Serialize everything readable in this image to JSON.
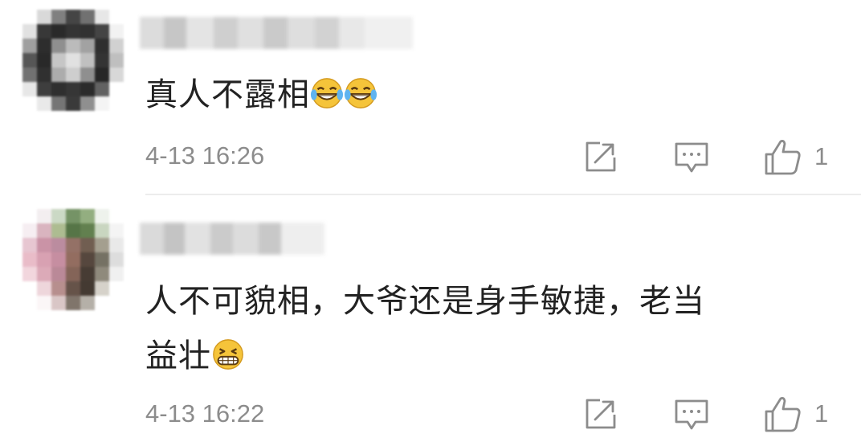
{
  "comments": [
    {
      "text": "真人不露相",
      "emojis": [
        "laughing-tears-emoji",
        "laughing-tears-emoji"
      ],
      "time": "4-13 16:26",
      "like_count": "1",
      "icons": [
        "share-icon",
        "reply-icon",
        "like-icon"
      ]
    },
    {
      "text": "人不可貌相，大爷还是身手敏捷，老当\n益壮",
      "emojis": [
        "grinning-emoji"
      ],
      "time": "4-13 16:22",
      "like_count": "1",
      "icons": [
        "share-icon",
        "reply-icon",
        "like-icon"
      ]
    }
  ],
  "colors": {
    "text": "#222222",
    "meta": "#8c8c8c",
    "divider": "#ececec",
    "emoji_face": "#f5c43a"
  }
}
